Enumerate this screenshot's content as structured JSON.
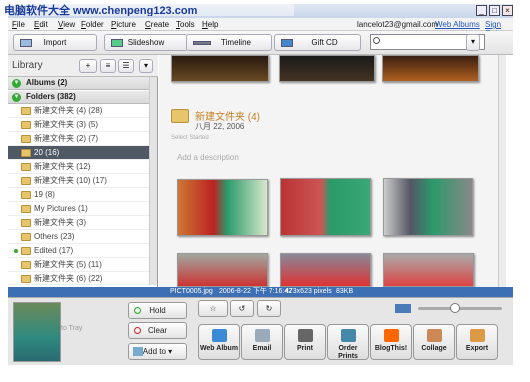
{
  "watermark": "电脑软件大全 www.chenpeng123.com",
  "menu": [
    "File",
    "Edit",
    "View",
    "Folder",
    "Picture",
    "Create",
    "Tools",
    "Help"
  ],
  "account": {
    "email": "lancelot23@gmail.com",
    "web_albums": "Web Albums",
    "sign_out": "Sign Out"
  },
  "toolbar": {
    "import": "Import",
    "slideshow": "Slideshow",
    "timeline": "Timeline",
    "giftcd": "Gift CD",
    "search_value": ""
  },
  "library": {
    "title": "Library"
  },
  "albums": "Albums (2)",
  "folders": "Folders (382)",
  "folder_items": [
    "新建文件夹 (4) (28)",
    "新建文件夹 (3) (5)",
    "新建文件夹 (2) (7)",
    "20 (16)",
    "新建文件夹 (12)",
    "新建文件夹 (10) (17)",
    "19 (8)",
    "My Pictures (1)",
    "新建文件夹 (3)",
    "Others (23)",
    "Edited (17)",
    "新建文件夹 (5) (11)",
    "新建文件夹 (6) (22)"
  ],
  "folder_view": {
    "name": "新建文件夹 (4)",
    "date": "八月 22, 2006",
    "sub": "Select Started",
    "desc_placeholder": "Add a description"
  },
  "status": {
    "file": "PICT0005.jpg",
    "date": "2006-8-22 下午 7:16:42",
    "size": "473x623 pixels",
    "kb": "83KB"
  },
  "tray": {
    "hold": "Hold",
    "clear": "Clear",
    "addto": "Add to",
    "to_tray": "to Tray"
  },
  "actions": [
    "Web Album",
    "Email",
    "Print",
    "Order Prints",
    "BlogThis!",
    "Collage",
    "Export"
  ],
  "window": {
    "minimize": "_",
    "maximize": "□",
    "close": "×"
  }
}
